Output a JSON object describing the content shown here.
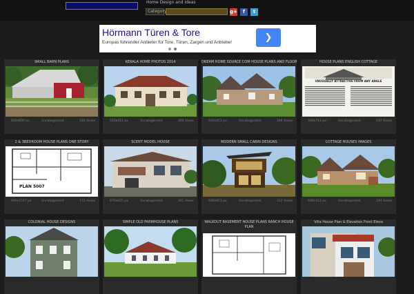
{
  "header": {
    "site_title": "Home Design and Ideas",
    "category_label": "Category",
    "category_value": "",
    "social": [
      "g+",
      "f",
      "t"
    ]
  },
  "ad": {
    "title": "Hörmann Türen & Tore",
    "text": "Europas führender Anbieter für Tore, Türen, Zargen und Antriebe!",
    "button_icon": "chevron-right-icon"
  },
  "cards": [
    {
      "title": "SMALL BARN PLANS",
      "res": "800x600 px",
      "cat": "Uncategorized",
      "views": "183 Views"
    },
    {
      "title": "KERALA HOME PHOTOS 2014",
      "res": "550x411 px",
      "cat": "Uncategorized",
      "views": "303 Views"
    },
    {
      "title": "DREAM HOME SOURCE COM HOUSE PLANS AND FLOOR P",
      "res": "600x413 px",
      "cat": "Uncategorized",
      "views": "186 Views"
    },
    {
      "title": "HOUSE PLANS ENGLISH COTTAGE",
      "res": "590x711 px",
      "cat": "Uncategorized",
      "views": "237 Views"
    },
    {
      "title": "2 & 3BEDROOM HOUSE PLANS ONE STORY",
      "res": "940x1517 px",
      "cat": "Uncategorized",
      "views": "172 Views"
    },
    {
      "title": "SCENT MODEL HOUSE",
      "res": "870x625 px",
      "cat": "Uncategorized",
      "views": "401 Views"
    },
    {
      "title": "MODERN SMALL CABIN DESIGNS",
      "res": "600x613 px",
      "cat": "Uncategorized",
      "views": "312 Views"
    },
    {
      "title": "COTTAGE HOUSES IMAGES",
      "res": "600x512 px",
      "cat": "Uncategorized",
      "views": "244 Views"
    },
    {
      "title": "COLONIAL HOUSE DESIGNS",
      "res": "",
      "cat": "",
      "views": ""
    },
    {
      "title": "SIMPLE OLD FARMHOUSE PLANS",
      "res": "",
      "cat": "",
      "views": ""
    },
    {
      "title": "WALKOUT BASEMENT HOUSE PLANS RANCH HOUSE PLAN",
      "res": "",
      "cat": "",
      "views": ""
    },
    {
      "title": "Villa House Plan & Elevation Front Eleva",
      "res": "",
      "cat": "",
      "views": ""
    }
  ],
  "thumb_text": {
    "plan_label": "PLAN 5007",
    "cottage_heading": "UNUSUALLY ATTRACTIVE FROM ANY ANGLE"
  }
}
